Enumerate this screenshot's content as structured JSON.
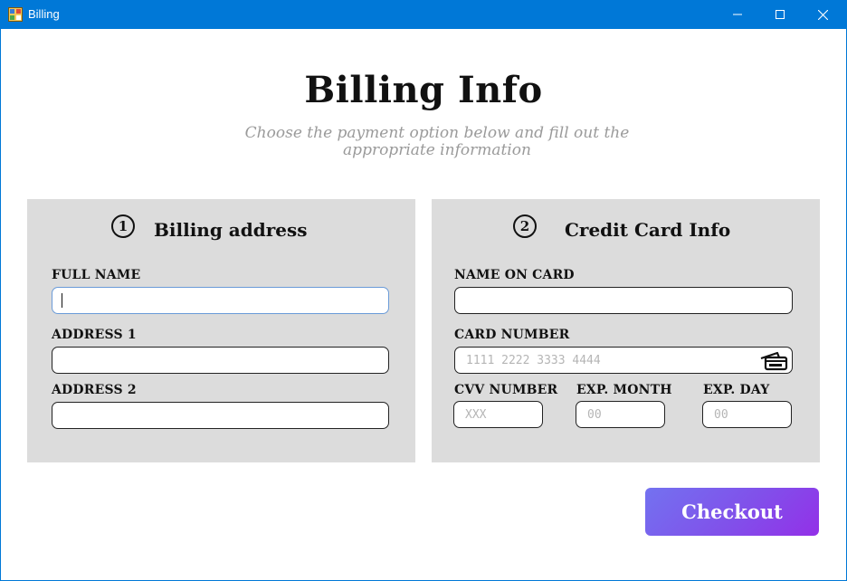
{
  "window": {
    "title": "Billing",
    "icon": "app-window-icon",
    "controls": [
      "minimize-icon",
      "maximize-icon",
      "close-icon"
    ],
    "accent": "#0078d7"
  },
  "header": {
    "title": "Billing Info",
    "subtitle_line1": "Choose the payment option below and fill out the",
    "subtitle_line2": "appropriate information"
  },
  "billing": {
    "step": "1",
    "title": "Billing address",
    "full_name_label": "FULL NAME",
    "full_name_value": "",
    "address1_label": "ADDRESS 1",
    "address1_value": "",
    "address2_label": "ADDRESS 2",
    "address2_value": ""
  },
  "card": {
    "step": "2",
    "title": "Credit Card Info",
    "name_label": "NAME ON CARD",
    "name_value": "",
    "number_label": "CARD NUMBER",
    "number_placeholder": "1111 2222 3333 4444",
    "cvv_label": "CVV NUMBER",
    "cvv_placeholder": "XXX",
    "month_label": "EXP. MONTH",
    "month_placeholder": "00",
    "day_label": "EXP. DAY",
    "day_placeholder": "00",
    "number_icon": "credit-card-icon"
  },
  "actions": {
    "checkout_label": "Checkout",
    "gradient": [
      "#7372f0",
      "#9330e8"
    ]
  },
  "colors": {
    "panel": "#dcdcdc",
    "subtitle": "#9a9a9a",
    "focus_border": "#6a9bd8"
  }
}
